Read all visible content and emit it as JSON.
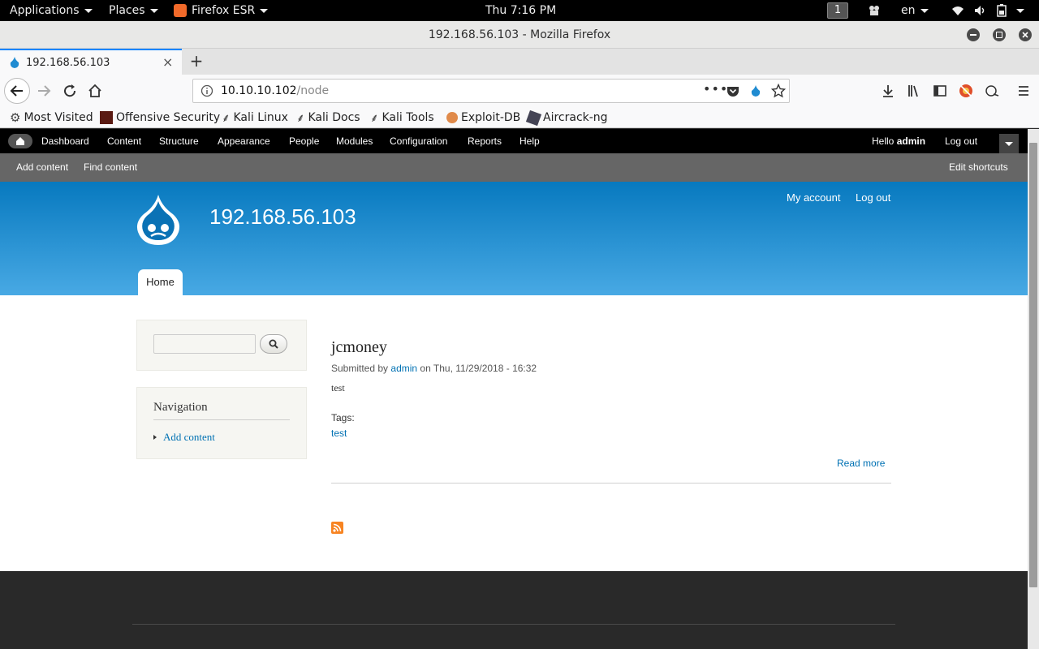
{
  "desktop": {
    "applications": "Applications",
    "places": "Places",
    "firefox": "Firefox ESR",
    "clock": "Thu  7:16 PM",
    "workspace": "1",
    "lang": "en"
  },
  "window": {
    "title": "192.168.56.103 - Mozilla Firefox",
    "tab_title": "192.168.56.103",
    "url_host": "10.10.10.102",
    "url_path": "/node"
  },
  "bookmarks": [
    "Most Visited",
    "Offensive Security",
    "Kali Linux",
    "Kali Docs",
    "Kali Tools",
    "Exploit-DB",
    "Aircrack-ng"
  ],
  "drupal": {
    "toolbar": [
      "Dashboard",
      "Content",
      "Structure",
      "Appearance",
      "People",
      "Modules",
      "Configuration",
      "Reports",
      "Help"
    ],
    "hello": "Hello",
    "user": "admin",
    "logout": "Log out",
    "shortcuts": [
      "Add content",
      "Find content"
    ],
    "edit_shortcuts": "Edit shortcuts",
    "site_name": "192.168.56.103",
    "my_account": "My account",
    "header_logout": "Log out",
    "home_tab": "Home",
    "nav_title": "Navigation",
    "nav_item": "Add content"
  },
  "article": {
    "title": "jcmoney",
    "submitted_prefix": "Submitted by",
    "author": "admin",
    "submitted_suffix": "on Thu, 11/29/2018 - 16:32",
    "body": "test",
    "tags_label": "Tags:",
    "tag": "test",
    "read_more": "Read more"
  },
  "colors": {
    "drupal_blue": "#0779bf",
    "link": "#0071b3",
    "rss": "#f78422"
  }
}
